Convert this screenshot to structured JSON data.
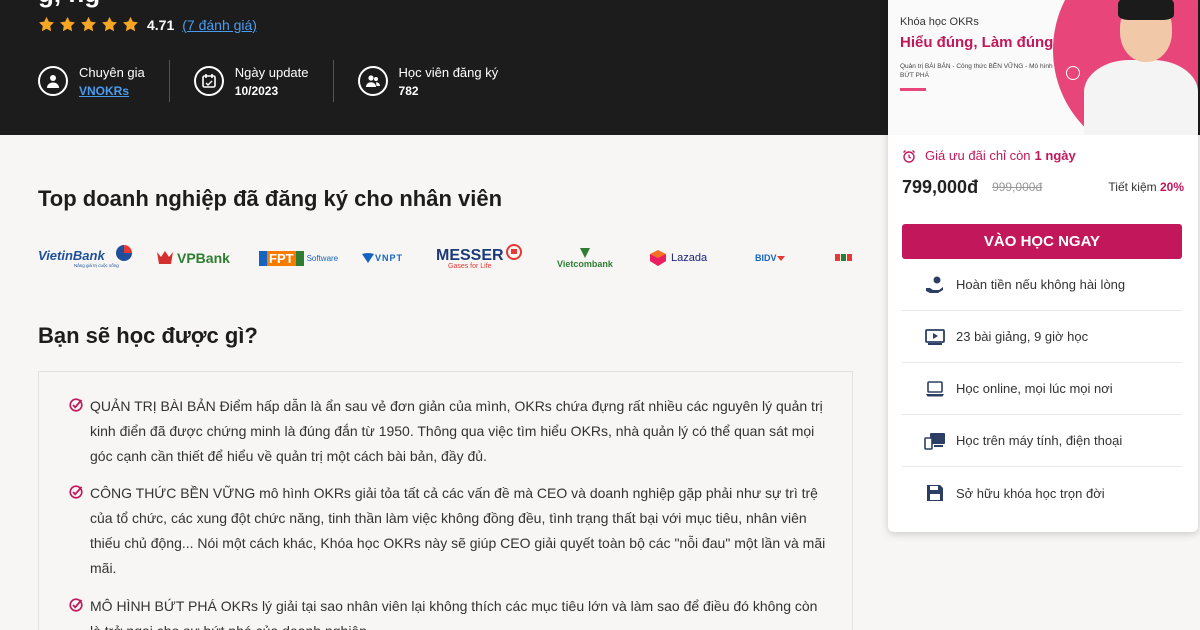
{
  "header": {
    "title_fragment": "g,   ng",
    "rating_value": "4.71",
    "rating_link": "(7 đánh giá)",
    "rating_stars": 4.71,
    "meta": [
      {
        "label": "Chuyên gia",
        "value": "VNOKRs",
        "icon": "user-circle-icon"
      },
      {
        "label": "Ngày update",
        "value": "10/2023",
        "icon": "calendar-icon"
      },
      {
        "label": "Học viên đăng ký",
        "value": "782",
        "icon": "users-icon"
      }
    ]
  },
  "companies": {
    "title": "Top doanh nghiệp đã đăng ký cho nhân viên",
    "logos": [
      {
        "name": "VietinBank",
        "tagline": "Nâng giá trị cuộc sống"
      },
      {
        "name": "VPBank"
      },
      {
        "name": "FPT",
        "suffix": "Software"
      },
      {
        "name": "VNPT"
      },
      {
        "name": "MESSER",
        "tagline": "Gases for Life"
      },
      {
        "name": "Vietcombank"
      },
      {
        "name": "Lazada"
      },
      {
        "name": "BIDV"
      }
    ]
  },
  "learn": {
    "title": "Bạn sẽ học được gì?",
    "items": [
      "QUẢN TRỊ BÀI BẢN Điểm hấp dẫn là ẩn sau vẻ đơn giản của mình, OKRs chứa đựng rất nhiều các nguyên lý quản trị kinh điển đã được chứng minh là đúng đắn từ 1950. Thông qua việc tìm hiểu OKRs, nhà quản lý có thể quan sát mọi góc cạnh cần thiết để hiểu về quản trị một cách bài bản, đầy đủ.",
      "CÔNG THỨC BỀN VỮNG mô hình OKRs giải tỏa tất cả các vấn đề mà CEO và doanh nghiệp gặp phải như sự trì trệ của tổ chức, các xung đột chức năng, tinh thần làm việc không đồng đều, tình trạng thất bại với mục tiêu, nhân viên thiếu chủ động... Nói một cách khác, Khóa học OKRs này sẽ giúp CEO giải quyết toàn bộ các \"nỗi đau\" một lần và mãi mãi.",
      "MÔ HÌNH BỨT PHÁ OKRs lý giải tại sao nhân viên lại không thích các mục tiêu lớn và làm sao để điều đó không còn là trở ngại cho sự bứt phá của doanh nghiệp."
    ]
  },
  "card": {
    "banner_small": "Khóa học OKRs",
    "banner_big": "Hiểu đúng, Làm đúng",
    "banner_sub": "Quản trị BÀI BẢN - Công thức BỀN VỮNG - Mô hình BỨT PHÁ",
    "deal_text": "Giá ưu đãi chỉ còn",
    "deal_days": "1 ngày",
    "price": "799,000đ",
    "old_price": "999,000đ",
    "save_label": "Tiết kiệm",
    "save_percent": "20%",
    "cta": "VÀO HỌC NGAY",
    "features": [
      {
        "label": "Hoàn tiền nếu không hài lòng",
        "icon": "refund-hand-icon"
      },
      {
        "label": "23 bài giảng, 9 giờ học",
        "icon": "video-lesson-icon"
      },
      {
        "label": "Học online, mọi lúc mọi nơi",
        "icon": "laptop-icon"
      },
      {
        "label": "Học trên máy tính, điện thoại",
        "icon": "devices-icon"
      },
      {
        "label": "Sở hữu khóa học trọn đời",
        "icon": "save-disk-icon"
      }
    ]
  },
  "colors": {
    "accent": "#c2185b",
    "star": "#f5a623",
    "link": "#4a9cf0",
    "header_bg": "#1c1c1c"
  }
}
